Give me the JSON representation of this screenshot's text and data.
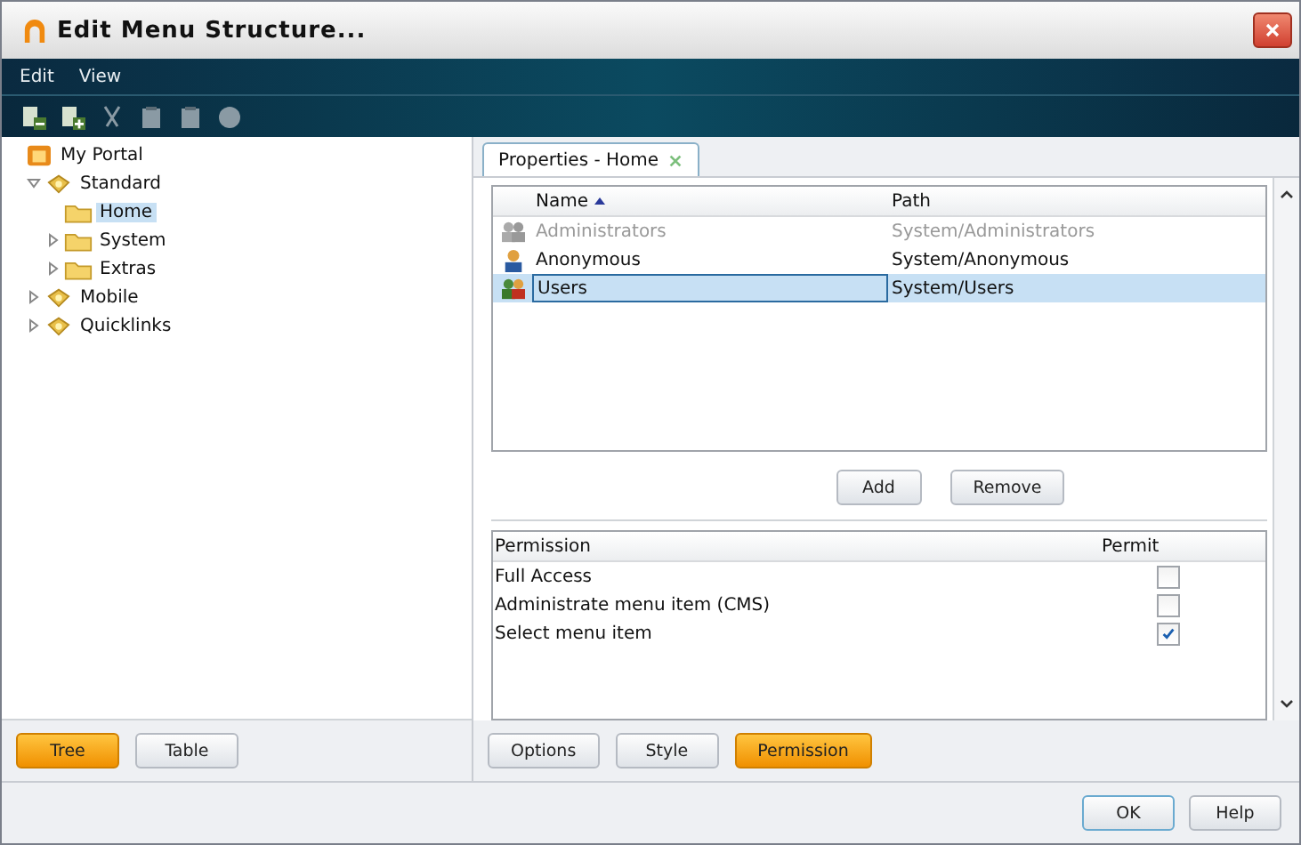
{
  "window": {
    "title": "Edit Menu Structure..."
  },
  "menu": [
    {
      "label": "Edit"
    },
    {
      "label": "View"
    }
  ],
  "toolbar": [
    {
      "kind": "page-minus",
      "disabled": false
    },
    {
      "kind": "page-plus",
      "disabled": false
    },
    {
      "kind": "cut",
      "disabled": true
    },
    {
      "kind": "copy",
      "disabled": true
    },
    {
      "kind": "paste",
      "disabled": true
    },
    {
      "kind": "delete",
      "disabled": true
    }
  ],
  "tree": [
    {
      "label": "My Portal",
      "kind": "portal",
      "children": [
        {
          "label": "Standard",
          "kind": "group",
          "expanded": true,
          "selected": false,
          "children": [
            {
              "label": "Home",
              "kind": "folder",
              "selected": true
            },
            {
              "label": "System",
              "kind": "folder",
              "expanded": false,
              "selected": false
            },
            {
              "label": "Extras",
              "kind": "folder",
              "expanded": false,
              "selected": false
            }
          ]
        },
        {
          "label": "Mobile",
          "kind": "group",
          "expanded": false,
          "selected": false
        },
        {
          "label": "Quicklinks",
          "kind": "group",
          "expanded": false,
          "selected": false
        }
      ]
    }
  ],
  "view_buttons": [
    {
      "label": "Tree",
      "selected": true
    },
    {
      "label": "Table",
      "selected": false
    }
  ],
  "tab": {
    "label": "Properties - Home"
  },
  "principals": {
    "columns": [
      "Name",
      "Path"
    ],
    "rows": [
      {
        "name": "Administrators",
        "path": "System/Administrators",
        "kind": "group",
        "disabled": true,
        "selected": false
      },
      {
        "name": "Anonymous",
        "path": "System/Anonymous",
        "kind": "user",
        "disabled": false,
        "selected": false
      },
      {
        "name": "Users",
        "path": "System/Users",
        "kind": "group",
        "disabled": false,
        "selected": true
      }
    ]
  },
  "principal_buttons": [
    "Add",
    "Remove"
  ],
  "permissions": {
    "columns": [
      "Permission",
      "Permit"
    ],
    "rows": [
      {
        "label": "Full Access",
        "checked": false
      },
      {
        "label": "Administrate menu item (CMS)",
        "checked": false
      },
      {
        "label": "Select menu item",
        "checked": true
      }
    ]
  },
  "section_buttons": [
    {
      "label": "Options",
      "selected": false
    },
    {
      "label": "Style",
      "selected": false
    },
    {
      "label": "Permission",
      "selected": true
    }
  ],
  "dialog_buttons": [
    {
      "label": "OK",
      "default": true
    },
    {
      "label": "Help",
      "default": false
    }
  ]
}
